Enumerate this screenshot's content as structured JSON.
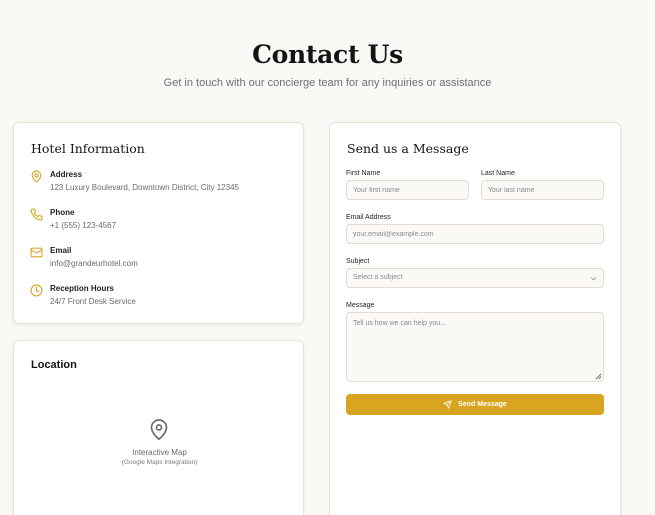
{
  "header": {
    "title": "Contact Us",
    "subtitle": "Get in touch with our concierge team for any inquiries or assistance"
  },
  "hotel_info": {
    "title": "Hotel Information",
    "items": [
      {
        "icon": "map-pin-icon",
        "label": "Address",
        "value": "123 Luxury Boulevard, Downtown District, City 12345"
      },
      {
        "icon": "phone-icon",
        "label": "Phone",
        "value": "+1 (555) 123-4567"
      },
      {
        "icon": "mail-icon",
        "label": "Email",
        "value": "info@grandeurhotel.com"
      },
      {
        "icon": "clock-icon",
        "label": "Reception Hours",
        "value": "24/7 Front Desk Service"
      }
    ]
  },
  "location": {
    "title": "Location",
    "map_title": "Interactive Map",
    "map_subtitle": "(Google Maps Integration)"
  },
  "message_form": {
    "title": "Send us a Message",
    "first_name": {
      "label": "First Name",
      "placeholder": "Your first name"
    },
    "last_name": {
      "label": "Last Name",
      "placeholder": "Your last name"
    },
    "email": {
      "label": "Email Address",
      "placeholder": "your.email@example.com"
    },
    "subject": {
      "label": "Subject",
      "selected": "Select a subject"
    },
    "message": {
      "label": "Message",
      "placeholder": "Tell us how we can help you..."
    },
    "submit_label": "Send Message"
  },
  "colors": {
    "accent": "#d9a521",
    "background": "#fbf9f5",
    "card": "#ffffff"
  }
}
